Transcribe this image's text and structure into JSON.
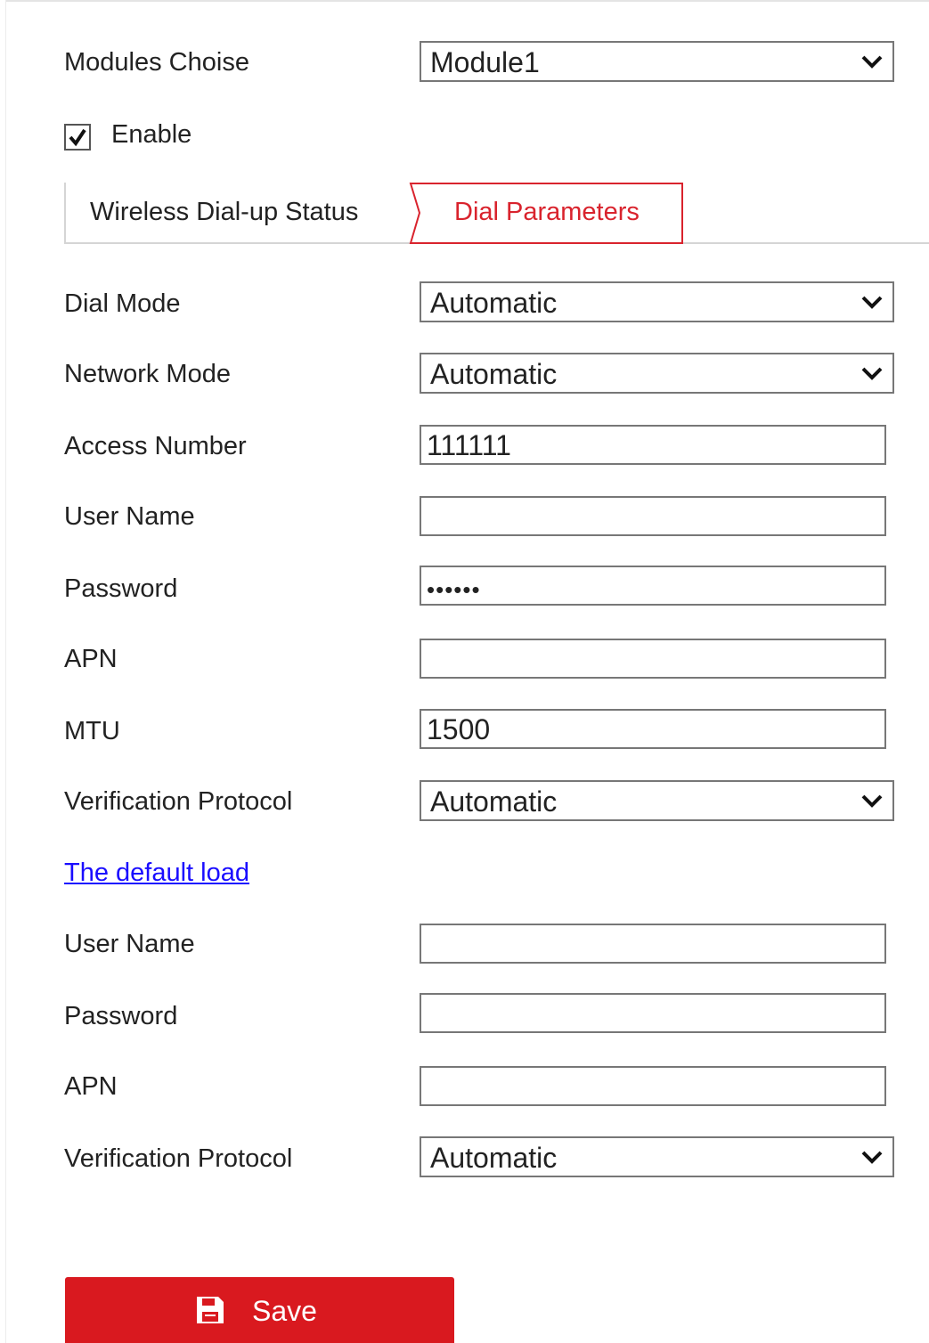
{
  "module": {
    "label": "Modules Choise",
    "value": "Module1"
  },
  "enable": {
    "label": "Enable",
    "checked": true
  },
  "tabs": [
    {
      "label": "Wireless Dial-up Status",
      "active": false
    },
    {
      "label": "Dial Parameters",
      "active": true
    }
  ],
  "dial": {
    "dial_mode": {
      "label": "Dial Mode",
      "value": "Automatic"
    },
    "network_mode": {
      "label": "Network Mode",
      "value": "Automatic"
    },
    "access_number": {
      "label": "Access Number",
      "value": "111111"
    },
    "user_name": {
      "label": "User Name",
      "value": ""
    },
    "password": {
      "label": "Password",
      "value": "••••••"
    },
    "apn": {
      "label": "APN",
      "value": ""
    },
    "mtu": {
      "label": "MTU",
      "value": "1500"
    },
    "verification_protocol": {
      "label": "Verification Protocol",
      "value": "Automatic"
    }
  },
  "default_load": {
    "link_label": "The default load",
    "user_name": {
      "label": "User Name",
      "value": ""
    },
    "password": {
      "label": "Password",
      "value": ""
    },
    "apn": {
      "label": "APN",
      "value": ""
    },
    "verification_protocol": {
      "label": "Verification Protocol",
      "value": "Automatic"
    }
  },
  "save": {
    "label": "Save",
    "icon": "floppy-disk-icon"
  },
  "colors": {
    "accent": "#d9191f",
    "link": "#1a0dff",
    "active_tab_text": "#d9232d"
  }
}
